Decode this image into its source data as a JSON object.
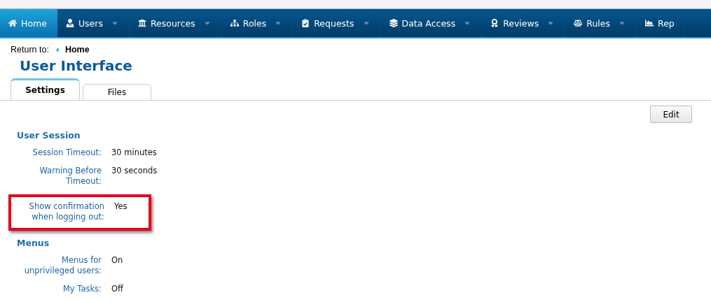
{
  "nav": [
    {
      "label": "Home",
      "selected": true,
      "dropdown": false
    },
    {
      "label": "Users",
      "selected": false,
      "dropdown": true
    },
    {
      "label": "Resources",
      "selected": false,
      "dropdown": true
    },
    {
      "label": "Roles",
      "selected": false,
      "dropdown": true
    },
    {
      "label": "Requests",
      "selected": false,
      "dropdown": true
    },
    {
      "label": "Data Access",
      "selected": false,
      "dropdown": true
    },
    {
      "label": "Reviews",
      "selected": false,
      "dropdown": true
    },
    {
      "label": "Rules",
      "selected": false,
      "dropdown": true
    },
    {
      "label": "Rep",
      "selected": false,
      "dropdown": false
    }
  ],
  "breadcrumb": {
    "prefix": "Return to:",
    "link": "Home"
  },
  "title": "User Interface",
  "tabs": [
    {
      "label": "Settings",
      "selected": true
    },
    {
      "label": "Files",
      "selected": false
    }
  ],
  "edit_button": "Edit",
  "sections": [
    {
      "heading": "User Session",
      "rows": [
        {
          "label": "Session Timeout:",
          "value": "30 minutes",
          "highlighted": false
        },
        {
          "label": "Warning Before Timeout:",
          "value": "30 seconds",
          "highlighted": false
        },
        {
          "label": "Show confirmation when logging out:",
          "value": "Yes",
          "highlighted": true
        }
      ]
    },
    {
      "heading": "Menus",
      "rows": [
        {
          "label": "Menus for unprivileged users:",
          "value": "On",
          "highlighted": false
        },
        {
          "label": "My Tasks:",
          "value": "Off",
          "highlighted": false
        }
      ]
    }
  ]
}
